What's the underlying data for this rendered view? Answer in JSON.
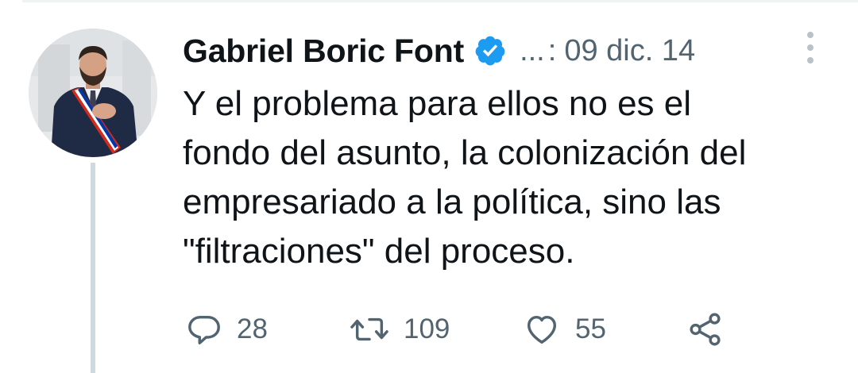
{
  "tweet": {
    "author_name": "Gabriel Boric Font",
    "handle": "...",
    "separator": ":",
    "timestamp": "09 dic. 14",
    "text": "Y el problema para ellos no es el\nfondo del asunto, la colonización del\nempresariado a la política, sino las\n\"filtraciones\" del proceso.",
    "verified": true,
    "avatar_icon": "profile-photo",
    "accent_color": "#1d9bf0"
  },
  "actions": {
    "reply": {
      "icon": "comment-icon",
      "count": "28"
    },
    "retweet": {
      "icon": "retweet-icon",
      "count": "109"
    },
    "like": {
      "icon": "heart-icon",
      "count": "55"
    },
    "share": {
      "icon": "share-icon"
    }
  }
}
